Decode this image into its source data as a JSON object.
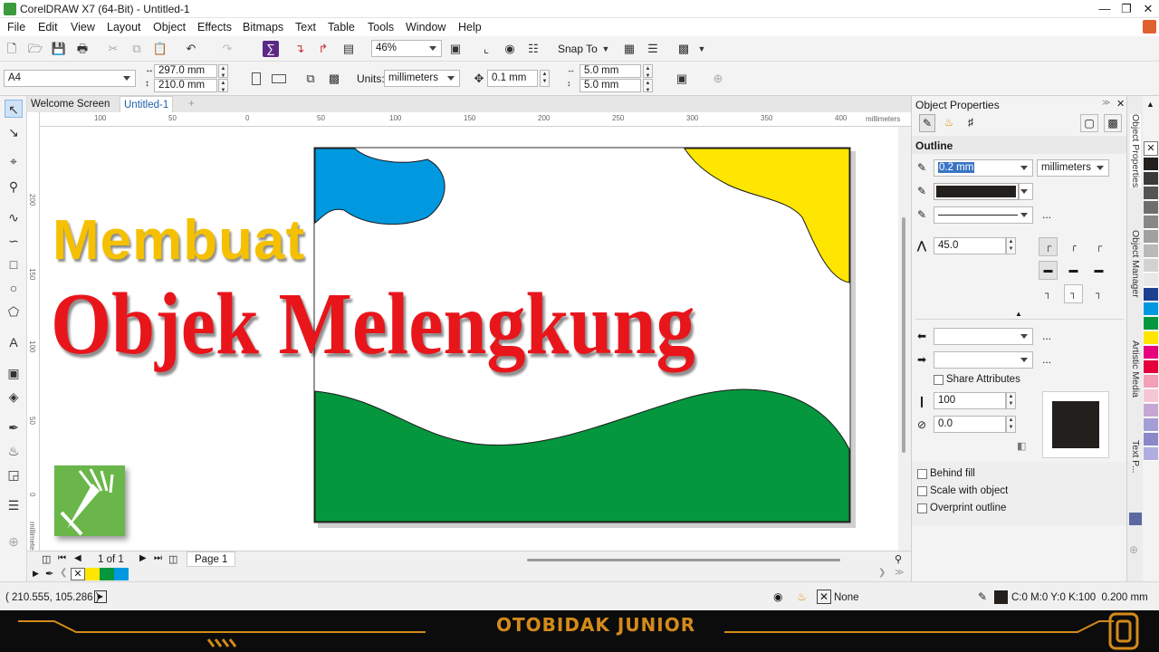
{
  "app": {
    "title": "CorelDRAW X7 (64-Bit) - Untitled-1",
    "window_buttons": [
      "—",
      "❐",
      "✕"
    ]
  },
  "menu": [
    "File",
    "Edit",
    "View",
    "Layout",
    "Object",
    "Effects",
    "Bitmaps",
    "Text",
    "Table",
    "Tools",
    "Window",
    "Help"
  ],
  "toolbar": {
    "zoom": "46%",
    "snap_to": "Snap To"
  },
  "propbar": {
    "page_size": "A4",
    "width": "297.0 mm",
    "height": "210.0 mm",
    "units_label": "Units:",
    "units": "millimeters",
    "nudge": "0.1 mm",
    "dup_x": "5.0 mm",
    "dup_y": "5.0 mm"
  },
  "doc_tabs": [
    "Welcome Screen",
    "Untitled-1"
  ],
  "hruler": {
    "labels": [
      "100",
      "50",
      "0",
      "50",
      "100",
      "150",
      "200",
      "250",
      "300",
      "350",
      "400"
    ],
    "unit": "millimeters"
  },
  "vruler": {
    "labels": [
      "200",
      "150",
      "100",
      "50",
      "0"
    ],
    "unit": "millimeters"
  },
  "canvas": {
    "line1": "Membuat",
    "line2": "Objek Melengkung",
    "shape_colors": {
      "blue": "#0099e0",
      "yellow": "#ffe600",
      "green": "#05973d"
    }
  },
  "pagenav": {
    "counter": "1 of 1",
    "page_tab": "Page 1"
  },
  "object_properties": {
    "title": "Object Properties",
    "section": "Outline",
    "width": "0.2 mm",
    "unit": "millimeters",
    "color": "#231f1c",
    "more": "...",
    "miter": "45.0",
    "share_attributes": "Share Attributes",
    "stretch": "100",
    "angle": "0.0",
    "behind_fill": "Behind fill",
    "scale_with_object": "Scale with object",
    "overprint_outline": "Overprint outline"
  },
  "docker_tabs": [
    "Object Properties",
    "Object Manager",
    "Artistic Media",
    "Text P..."
  ],
  "palette": [
    "#231f1c",
    "#3b3b3b",
    "#555555",
    "#6e6e6e",
    "#888888",
    "#a0a0a0",
    "#b9b9b9",
    "#d2d2d2",
    "#e8e8e8",
    "#1d3f8f",
    "#0099e0",
    "#05973d",
    "#ffe600",
    "#e6007e",
    "#e4003a",
    "#f29fb7",
    "#f7c6d6",
    "#c6a6d2",
    "#a39ed6",
    "#8a88c8",
    "#b0aee0"
  ],
  "status": {
    "coords": "( 210.555, 105.286 )",
    "fill": "None",
    "outline_info": "C:0 M:0 Y:0 K:100  0.200 mm"
  },
  "banner": {
    "text": "OTOBIDAK JUNIOR"
  }
}
